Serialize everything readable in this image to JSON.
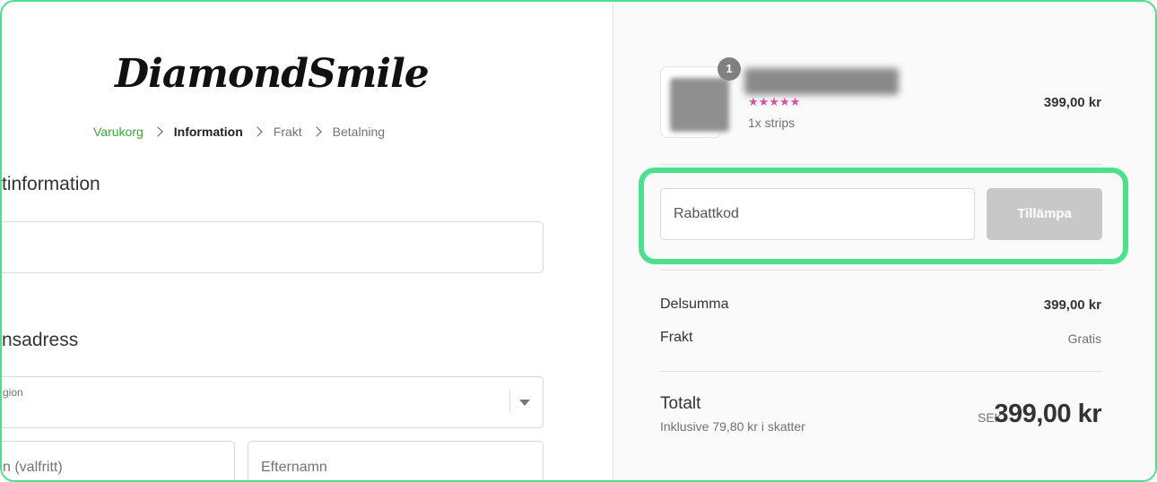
{
  "logo": {
    "text": "DiamondSmile"
  },
  "breadcrumb": [
    {
      "label": "Varukorg",
      "state": "done"
    },
    {
      "label": "Information",
      "state": "current"
    },
    {
      "label": "Frakt",
      "state": "upcoming"
    },
    {
      "label": "Betalning",
      "state": "upcoming"
    }
  ],
  "contact": {
    "title": "tinformation"
  },
  "shipping": {
    "title": "nsadress",
    "region_label": "gion",
    "first_name_placeholder": "n (valfritt)",
    "last_name_placeholder": "Efternamn"
  },
  "cart": {
    "item": {
      "quantity": "1",
      "stars": "★★★★★",
      "variant": "1x strips",
      "price": "399,00 kr"
    }
  },
  "discount": {
    "placeholder": "Rabattkod",
    "apply_label": "Tillämpa"
  },
  "summary": {
    "subtotal_label": "Delsumma",
    "subtotal_value": "399,00 kr",
    "shipping_label": "Frakt",
    "shipping_value": "Gratis",
    "total_label": "Totalt",
    "tax_note": "Inklusive 79,80 kr i skatter",
    "currency": "SEK",
    "total_value": "399,00 kr"
  },
  "colors": {
    "highlight": "#4be08e",
    "breadcrumb_done": "#3aa935",
    "stars": "#d94fa6",
    "apply_button": "#c8c8c8"
  }
}
